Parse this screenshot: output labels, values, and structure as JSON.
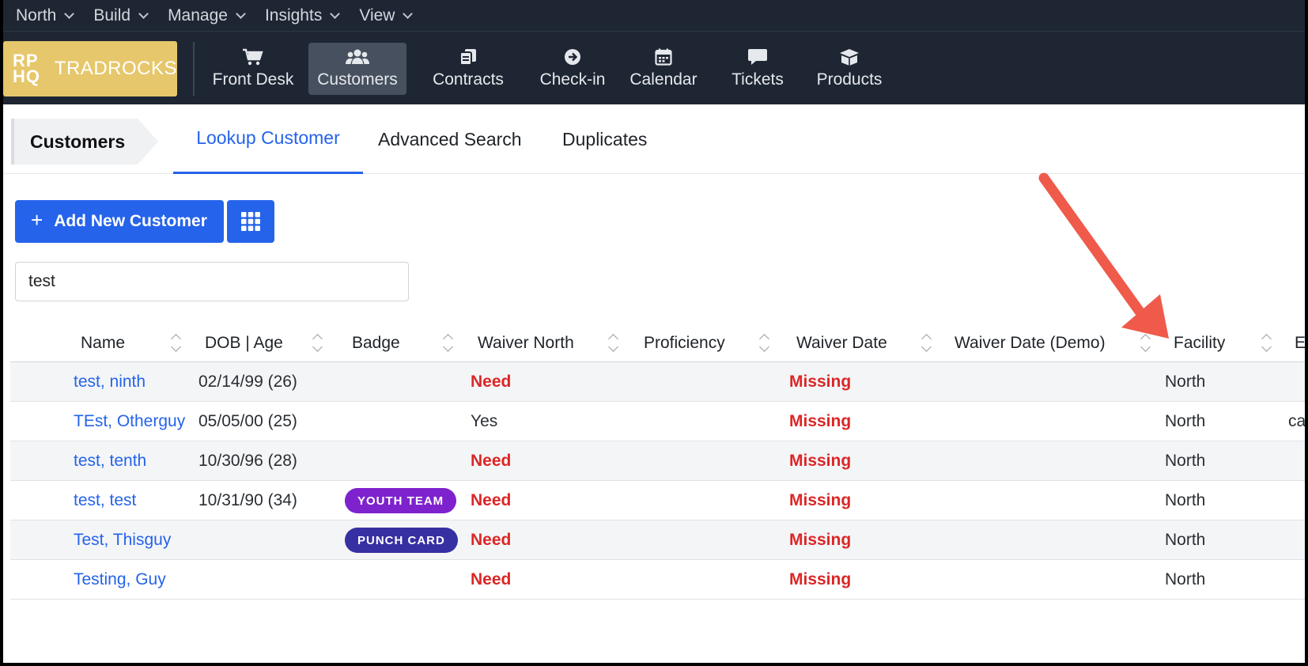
{
  "top_menu": [
    "North",
    "Build",
    "Manage",
    "Insights",
    "View"
  ],
  "logo": {
    "mark": "RP HQ",
    "mark_line1": "RP",
    "mark_line2": "HQ",
    "name": "TRADROCKS"
  },
  "nav": [
    {
      "label": "Front Desk",
      "icon": "cart-icon"
    },
    {
      "label": "Customers",
      "icon": "users-icon",
      "active": true
    },
    {
      "label": "Contracts",
      "icon": "contracts-icon"
    },
    {
      "label": "Check-in",
      "icon": "arrow-circle-icon"
    },
    {
      "label": "Calendar",
      "icon": "calendar-icon"
    },
    {
      "label": "Tickets",
      "icon": "chat-icon"
    },
    {
      "label": "Products",
      "icon": "box-icon"
    }
  ],
  "tabs": {
    "breadcrumb": "Customers",
    "items": [
      "Lookup Customer",
      "Advanced Search",
      "Duplicates"
    ],
    "active": "Lookup Customer"
  },
  "actions": {
    "add_label": "Add New Customer",
    "grid_icon": "grid-icon"
  },
  "search": {
    "value": "test"
  },
  "table": {
    "columns": [
      "Name",
      "DOB | Age",
      "Badge",
      "Waiver North",
      "Proficiency",
      "Waiver Date",
      "Waiver Date (Demo)",
      "Facility",
      "Em"
    ],
    "rows": [
      {
        "name": "test, ninth",
        "dob": "02/14/99 (26)",
        "badge": "",
        "waiver_north": "Need",
        "proficiency": "",
        "waiver_date": "Missing",
        "waiver_date_demo": "",
        "facility": "North",
        "email": ""
      },
      {
        "name": "TEst, Otherguy",
        "dob": "05/05/00 (25)",
        "badge": "",
        "waiver_north": "Yes",
        "proficiency": "",
        "waiver_date": "Missing",
        "waiver_date_demo": "",
        "facility": "North",
        "email": "ca"
      },
      {
        "name": "test, tenth",
        "dob": "10/30/96 (28)",
        "badge": "",
        "waiver_north": "Need",
        "proficiency": "",
        "waiver_date": "Missing",
        "waiver_date_demo": "",
        "facility": "North",
        "email": ""
      },
      {
        "name": "test, test",
        "dob": "10/31/90 (34)",
        "badge": "YOUTH TEAM",
        "waiver_north": "Need",
        "proficiency": "",
        "waiver_date": "Missing",
        "waiver_date_demo": "",
        "facility": "North",
        "email": ""
      },
      {
        "name": "Test, Thisguy",
        "dob": "",
        "badge": "PUNCH CARD",
        "waiver_north": "Need",
        "proficiency": "",
        "waiver_date": "Missing",
        "waiver_date_demo": "",
        "facility": "North",
        "email": ""
      },
      {
        "name": "Testing, Guy",
        "dob": "",
        "badge": "",
        "waiver_north": "Need",
        "proficiency": "",
        "waiver_date": "Missing",
        "waiver_date_demo": "",
        "facility": "North",
        "email": ""
      }
    ]
  },
  "colors": {
    "nav_bg": "#1e2633",
    "logo_bg": "#e6c76c",
    "accent": "#2563eb",
    "danger": "#dc2626",
    "badge_youth": "#7e22ce",
    "badge_punch": "#3730a3",
    "annotation": "#ef5a4a"
  }
}
